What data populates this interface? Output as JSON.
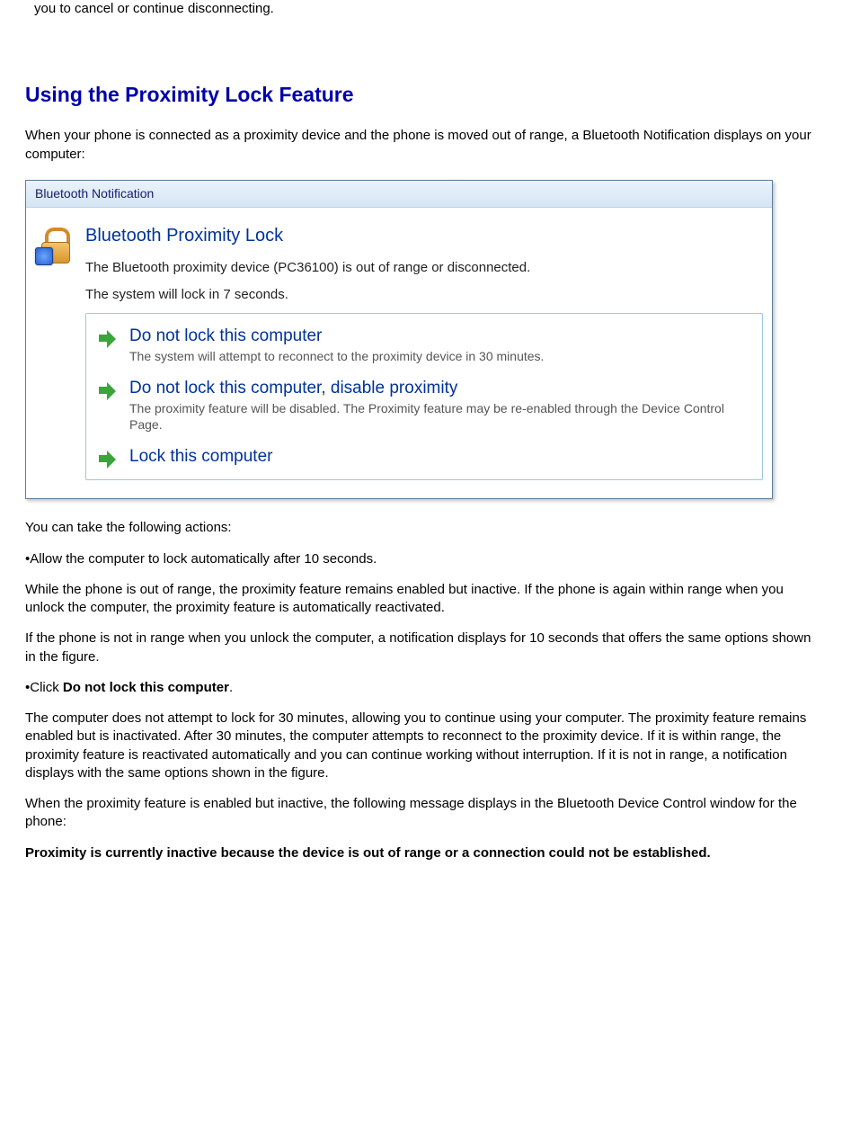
{
  "intro_fragment": "you to cancel or continue disconnecting.",
  "heading": "Using the Proximity Lock Feature",
  "para_connected": "When your phone is connected as a proximity device and the phone is moved out of range, a Bluetooth Notification displays on your computer:",
  "dialog": {
    "titlebar": "Bluetooth Notification",
    "title": "Bluetooth Proximity Lock",
    "line1": "The Bluetooth proximity device (PC36100) is out of range or disconnected.",
    "line2": "The system will lock in 7 seconds.",
    "options": [
      {
        "main": "Do not lock this computer",
        "sub": "The system will attempt to reconnect to the proximity device in 30 minutes."
      },
      {
        "main": "Do not lock this computer, disable proximity",
        "sub": "The proximity feature will be disabled.  The Proximity feature may be re-enabled through the Device Control Page."
      },
      {
        "main": "Lock this computer",
        "sub": ""
      }
    ]
  },
  "para_actions_intro": "You can take the following actions:",
  "bullet1": "•Allow the computer to lock automatically after 10 seconds.",
  "para_while_out": "While the phone is out of range, the proximity feature remains enabled but inactive. If the phone is again within range when you unlock the computer, the proximity feature is automatically reactivated.",
  "para_not_in_range": "If the phone is not in range when you unlock the computer, a notification displays for 10 seconds that offers the same options shown in the figure.",
  "bullet2_prefix": "•Click ",
  "bullet2_bold": "Do not lock this computer",
  "bullet2_suffix": ".",
  "para_30min": "The computer does not attempt to lock for 30 minutes, allowing you to continue using your computer. The proximity feature remains enabled but is inactivated. After 30 minutes, the computer attempts to reconnect to the proximity device. If it is within range, the proximity feature is reactivated automatically and you can continue working without interruption. If it is not in range, a notification displays with the same options shown in the figure.",
  "para_inactive_msg_intro": "When the proximity feature is enabled but inactive, the following message displays in the Bluetooth Device Control window for the phone:",
  "para_inactive_msg_bold": "Proximity is currently inactive because the device is out of range or a connection could not be established."
}
